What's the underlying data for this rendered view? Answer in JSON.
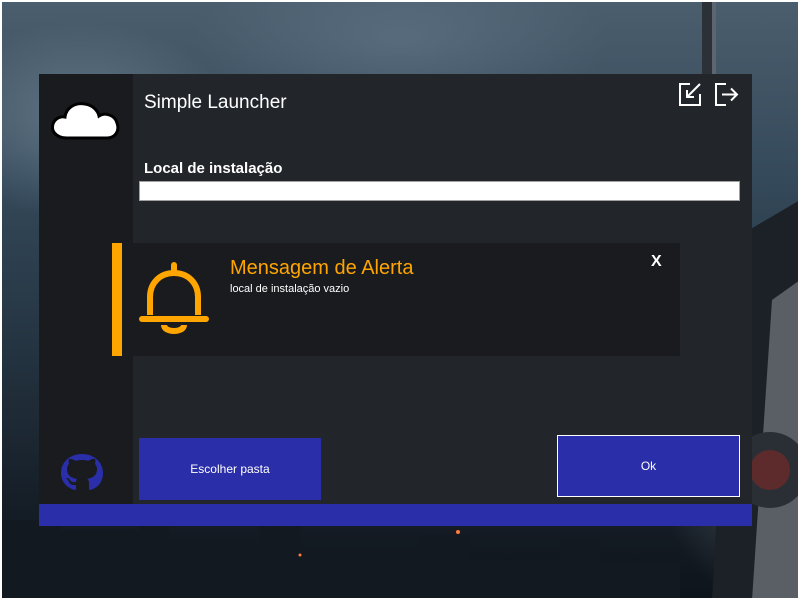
{
  "app": {
    "title": "Simple Launcher"
  },
  "toolbar": {
    "icons": [
      "minimize-icon",
      "exit-icon"
    ]
  },
  "install": {
    "label": "Local de instalação",
    "value": ""
  },
  "alert": {
    "title": "Mensagem de Alerta",
    "message": "local de instalação vazio",
    "close_label": "X",
    "accent_color": "#ffa500"
  },
  "buttons": {
    "choose_folder": "Escolher pasta",
    "ok": "Ok"
  },
  "sidebar": {
    "logo_icon": "cloud-icon",
    "github_icon": "github-icon"
  },
  "colors": {
    "accent": "#2a2ea8",
    "window_bg": "#22262b",
    "sidebar_bg": "#191b1e"
  }
}
